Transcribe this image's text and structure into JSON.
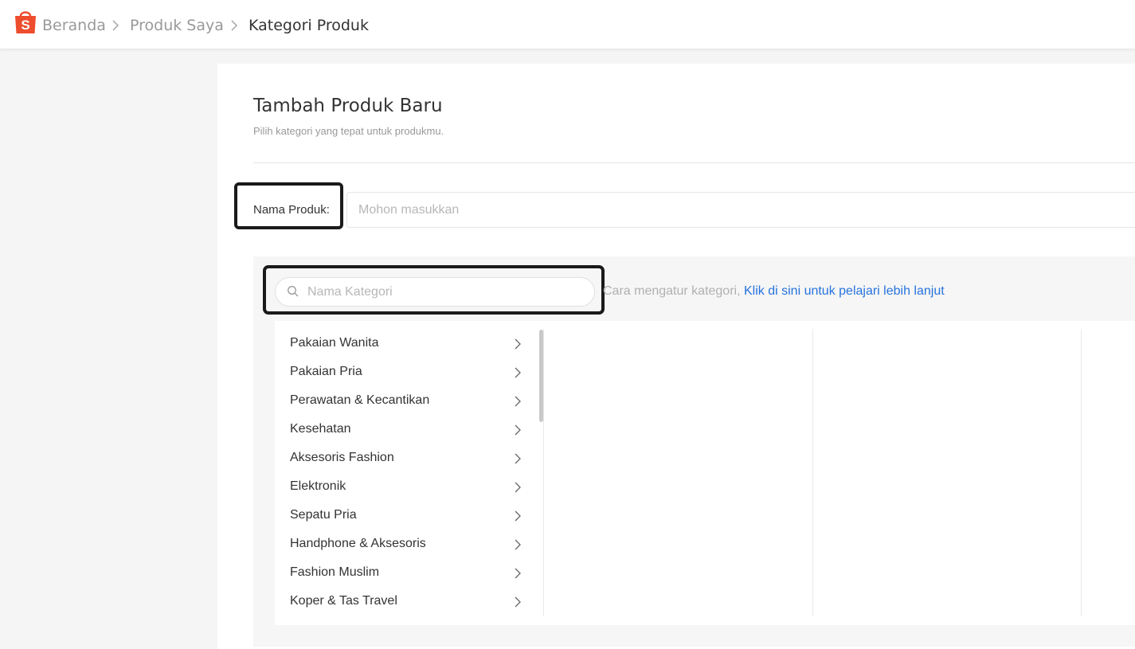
{
  "header": {
    "logo_icon": "shopee-bag-icon",
    "brand_color": "#ee4d2d",
    "breadcrumbs": [
      {
        "label": "Beranda"
      },
      {
        "label": "Produk Saya"
      },
      {
        "label": "Kategori Produk"
      }
    ]
  },
  "page": {
    "title": "Tambah Produk Baru",
    "subtitle": "Pilih kategori yang tepat untuk produkmu."
  },
  "product_name": {
    "label": "Nama Produk:",
    "value": "",
    "placeholder": "Mohon masukkan"
  },
  "category": {
    "search_placeholder": "Nama Kategori",
    "search_value": "",
    "help_text": "Cara mengatur kategori,",
    "help_link": "Klik di sini untuk pelajari lebih lanjut",
    "link_color": "#2673dd",
    "items": [
      {
        "label": "Pakaian Wanita"
      },
      {
        "label": "Pakaian Pria"
      },
      {
        "label": "Perawatan & Kecantikan"
      },
      {
        "label": "Kesehatan"
      },
      {
        "label": "Aksesoris Fashion"
      },
      {
        "label": "Elektronik"
      },
      {
        "label": "Sepatu Pria"
      },
      {
        "label": "Handphone & Aksesoris"
      },
      {
        "label": "Fashion Muslim"
      },
      {
        "label": "Koper & Tas Travel"
      }
    ]
  }
}
